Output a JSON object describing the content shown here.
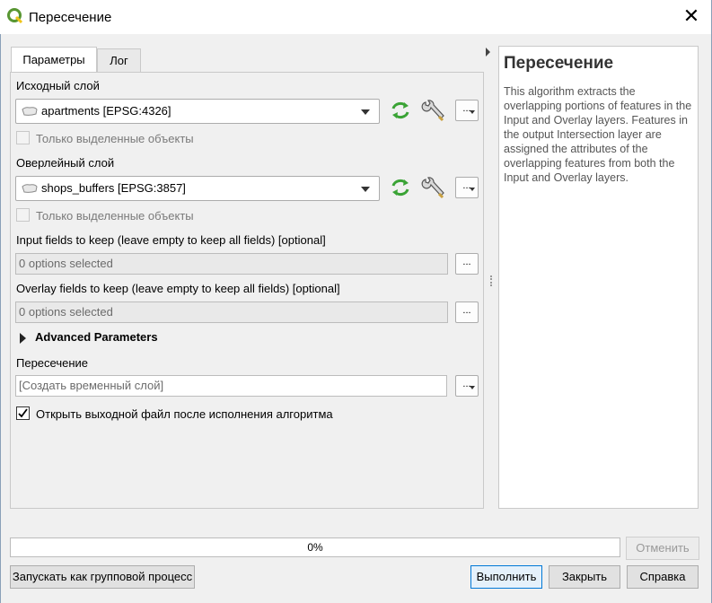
{
  "window": {
    "title": "Пересечение",
    "close_icon": "close-icon"
  },
  "tabs": [
    {
      "label": "Параметры",
      "active": true
    },
    {
      "label": "Лог",
      "active": false
    }
  ],
  "params": {
    "input_layer_label": "Исходный слой",
    "input_layer_value": "apartments [EPSG:4326]",
    "input_selected_only": "Только выделенные объекты",
    "overlay_layer_label": "Оверлейный слой",
    "overlay_layer_value": "shops_buffers [EPSG:3857]",
    "overlay_selected_only": "Только выделенные объекты",
    "input_fields_label": "Input fields to keep (leave empty to keep all fields) [optional]",
    "input_fields_value": "0 options selected",
    "overlay_fields_label": "Overlay fields to keep (leave empty to keep all fields) [optional]",
    "overlay_fields_value": "0 options selected",
    "advanced_label": "Advanced Parameters",
    "output_label": "Пересечение",
    "output_placeholder": "[Создать временный слой]",
    "open_output_label": "Открыть выходной файл после исполнения алгоритма",
    "open_output_checked": true,
    "dots_label": "..."
  },
  "help": {
    "title": "Пересечение",
    "text": "This algorithm extracts the overlapping portions of features in the Input and Overlay layers. Features in the output Intersection layer are assigned the attributes of the overlapping features from both the Input and Overlay layers."
  },
  "progress": {
    "value": 0,
    "text": "0%"
  },
  "buttons": {
    "cancel": "Отменить",
    "batch": "Запускать как групповой процесс",
    "run": "Выполнить",
    "close": "Закрыть",
    "help": "Справка"
  },
  "colors": {
    "qgis_green": "#589632",
    "accent": "#0078d7",
    "iterate_green": "#3aa335"
  }
}
